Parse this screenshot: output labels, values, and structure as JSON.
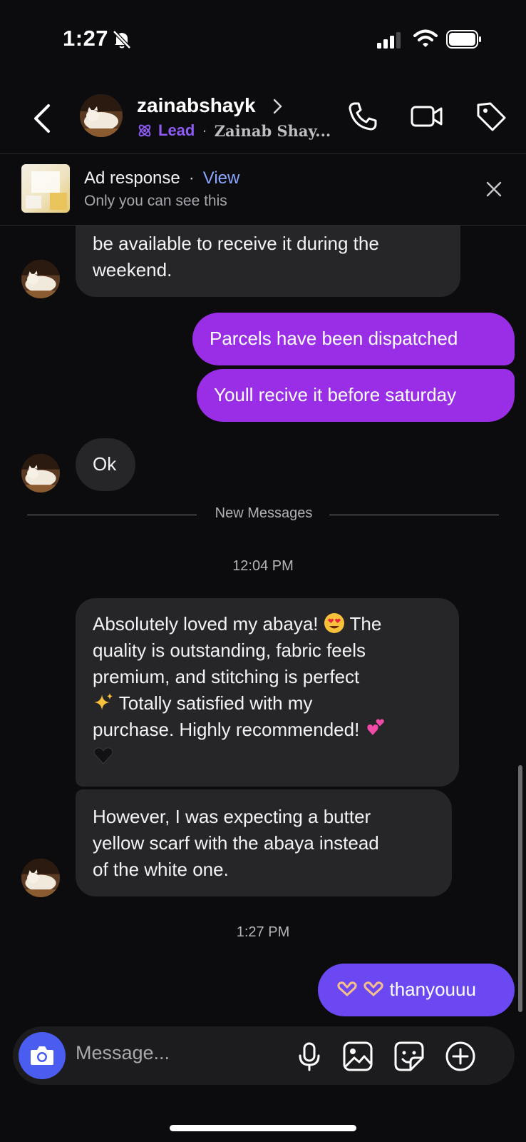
{
  "status_bar": {
    "time": "1:27",
    "icons": [
      "bell-off-icon",
      "signal-icon",
      "wifi-icon",
      "battery-icon"
    ]
  },
  "header": {
    "username": "zainabshayk",
    "lead_label": "Lead",
    "lead_separator": "·",
    "display_name": "Zainab Shay...",
    "icons": [
      "back-arrow-icon",
      "chevron-right-icon",
      "lead-icon",
      "phone-icon",
      "video-icon",
      "tag-icon"
    ]
  },
  "ad_banner": {
    "title": "Ad response",
    "separator": "·",
    "view_label": "View",
    "subtitle": "Only you can see this"
  },
  "messages": {
    "m1_line1": "be available to receive it during the",
    "m1_line2": "weekend.",
    "m2": "Parcels have been dispatched",
    "m3": "Youll recive it before saturday",
    "m4": "Ok",
    "divider": "New Messages",
    "time1": "12:04 PM",
    "m5_l1": "Absolutely loved my abaya!",
    "m5_l1b": "The",
    "m5_l2": "quality is outstanding, fabric feels",
    "m5_l3": "premium, and stitching is perfect",
    "m5_l4": "Totally satisfied with my",
    "m5_l5": "purchase. Highly recommended!",
    "m6_l1": "However, I was expecting a butter",
    "m6_l2": "yellow scarf with the abaya instead",
    "m6_l3": "of the white one.",
    "time2": "1:27 PM",
    "m7": "thanyouuu"
  },
  "composer": {
    "placeholder": "Message...",
    "icons": [
      "camera-icon",
      "microphone-icon",
      "gallery-icon",
      "sticker-icon",
      "plus-circle-icon"
    ]
  },
  "colors": {
    "background": "#0c0c0e",
    "incoming_bubble": "#262629",
    "outgoing_bubble": "#9a2ee6",
    "outgoing_bubble_last": "#6b48f2",
    "lead_accent": "#8e5cf5",
    "link": "#8aa6ff",
    "camera_button": "#4a5df0"
  }
}
